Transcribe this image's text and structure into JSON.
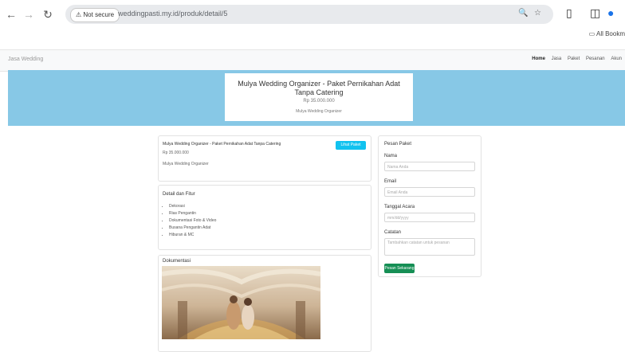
{
  "browser": {
    "secure_label": "Not secure",
    "url": "weddingpasti.my.id/produk/detail/5",
    "bookmarks_label": "All Bookm"
  },
  "site": {
    "brand": "Jasa Wedding",
    "nav": [
      "Home",
      "Jasa",
      "Paket",
      "Pesanan",
      "Akun"
    ]
  },
  "hero": {
    "title": "Mulya Wedding Organizer - Paket Pernikahan Adat Tanpa Catering",
    "price": "Rp 35.000.000",
    "vendor": "Mulya Wedding Organizer"
  },
  "product": {
    "title": "Mulya Wedding Organizer - Paket Pernikahan Adat Tanpa Catering",
    "price": "Rp 35.000.000",
    "vendor": "Mulya Wedding Organizer",
    "status_label": "Lihat Paket"
  },
  "includes": {
    "heading": "Detail dan Fitur",
    "items": [
      "Dekorasi",
      "Rias Pengantin",
      "Dokumentasi Foto & Video",
      "Busana Pengantin Adat",
      "Hiburan & MC"
    ]
  },
  "gallery": {
    "heading": "Dokumentasi"
  },
  "form": {
    "heading": "Pesan Paket",
    "name_label": "Nama",
    "name_placeholder": "Nama Anda",
    "email_label": "Email",
    "email_placeholder": "Email Anda",
    "date_label": "Tanggal Acara",
    "date_placeholder": "mm/dd/yyyy",
    "notes_label": "Catatan",
    "notes_placeholder": "Tambahkan catatan untuk pesanan",
    "submit_label": "Pesan Sekarang"
  },
  "colors": {
    "hero_bg": "#87c8e6",
    "accent_cyan": "#11c2ef",
    "accent_green": "#168f55"
  }
}
